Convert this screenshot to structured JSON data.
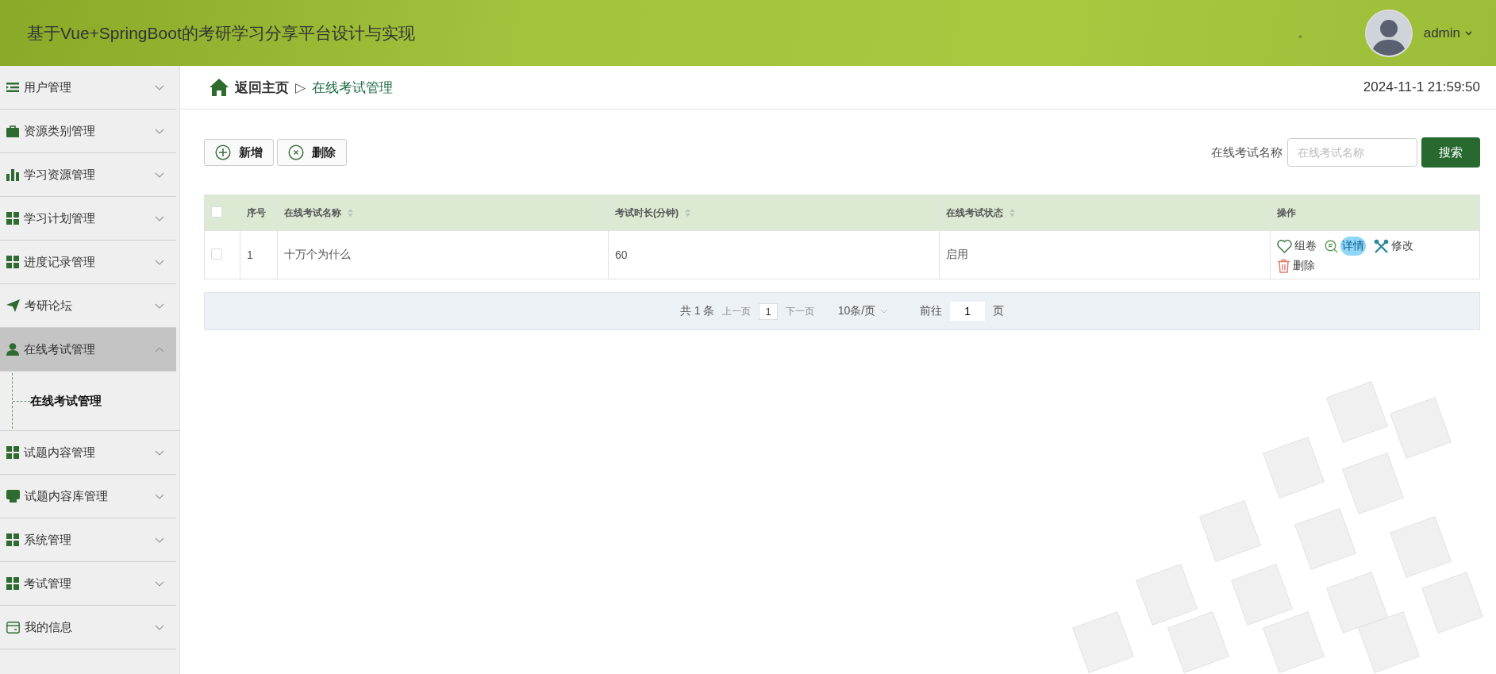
{
  "header": {
    "title": "基于Vue+SpringBoot的考研学习分享平台设计与实现",
    "mark": "。",
    "user": "admin"
  },
  "sidebar": {
    "items": [
      {
        "label": "用户管理",
        "kind": "list",
        "selected": false,
        "expanded": false
      },
      {
        "label": "资源类别管理",
        "kind": "briefcase",
        "selected": false,
        "expanded": false
      },
      {
        "label": "学习资源管理",
        "kind": "chart",
        "selected": false,
        "expanded": false
      },
      {
        "label": "学习计划管理",
        "kind": "grid",
        "selected": false,
        "expanded": false
      },
      {
        "label": "进度记录管理",
        "kind": "grid",
        "selected": false,
        "expanded": false
      },
      {
        "label": "考研论坛",
        "kind": "send",
        "selected": false,
        "expanded": false
      },
      {
        "label": "在线考试管理",
        "kind": "person",
        "selected": true,
        "expanded": true,
        "children": [
          {
            "label": "在线考试管理",
            "selected": true
          }
        ]
      },
      {
        "label": "试题内容管理",
        "kind": "grid",
        "selected": false,
        "expanded": false
      },
      {
        "label": "试题内容库管理",
        "kind": "tray",
        "selected": false,
        "expanded": false
      },
      {
        "label": "系统管理",
        "kind": "grid",
        "selected": false,
        "expanded": false
      },
      {
        "label": "考试管理",
        "kind": "grid",
        "selected": false,
        "expanded": false
      },
      {
        "label": "我的信息",
        "kind": "card",
        "selected": false,
        "expanded": false
      }
    ]
  },
  "breadcrumb": {
    "home": "返回主页",
    "separator": "▷",
    "current": "在线考试管理",
    "datetime": "2024-11-1 21:59:50"
  },
  "toolbar": {
    "buttons": [
      {
        "label": "新增",
        "kind": "add"
      },
      {
        "label": "删除",
        "kind": "remove"
      }
    ],
    "search": {
      "label": "在线考试名称",
      "placeholder": "在线考试名称",
      "button": "搜索"
    }
  },
  "table": {
    "all_checked": false,
    "columns": [
      {
        "label": "序号",
        "sortable": false
      },
      {
        "label": "在线考试名称",
        "sortable": true
      },
      {
        "label": "考试时长(分钟)",
        "sortable": true
      },
      {
        "label": "在线考试状态",
        "sortable": true
      },
      {
        "label": "操作",
        "sortable": false
      }
    ],
    "rows": [
      {
        "checked": false,
        "cells": [
          "1",
          "十万个为什么",
          "60",
          "启用"
        ],
        "actions": [
          {
            "label": "组卷",
            "kind": "heart",
            "hovered": false
          },
          {
            "label": "详情",
            "kind": "detail",
            "hovered": true
          },
          {
            "label": "修改",
            "kind": "tools",
            "hovered": false
          },
          {
            "label": "删除",
            "kind": "trash",
            "hovered": false
          }
        ]
      }
    ]
  },
  "pagination": {
    "total": "共 1 条",
    "prev": "上一页",
    "page": "1",
    "next": "下一页",
    "page_size": "10条/页",
    "goto": "前往",
    "goto_value": "1",
    "suffix": "页"
  }
}
